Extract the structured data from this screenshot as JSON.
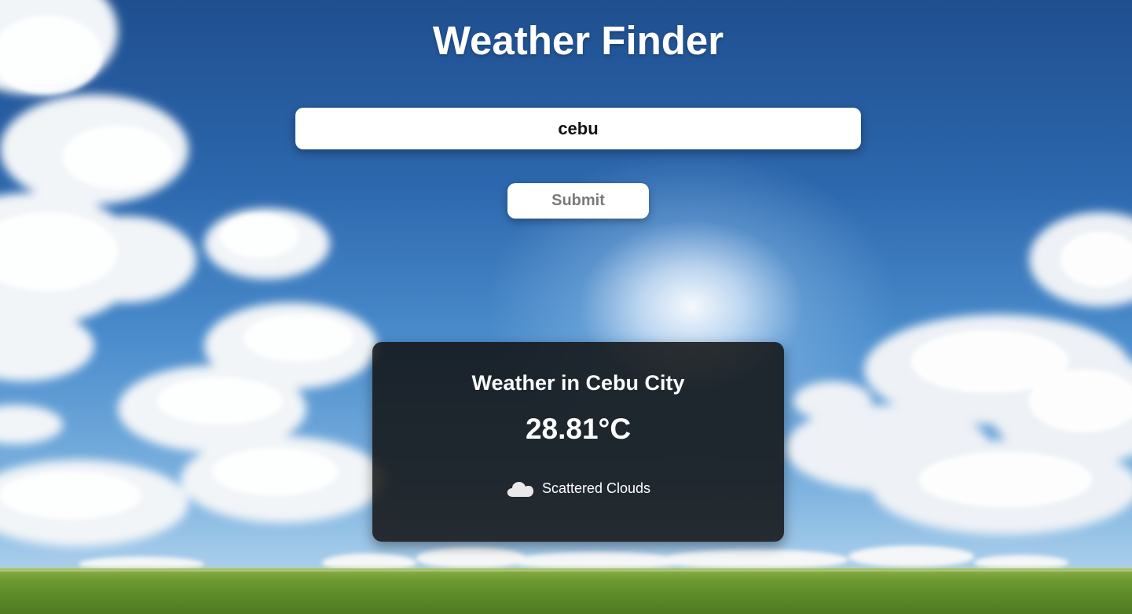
{
  "app": {
    "title": "Weather Finder"
  },
  "search": {
    "value": "cebu",
    "submit_label": "Submit"
  },
  "weather": {
    "location_heading": "Weather in Cebu City",
    "temperature": "28.81°C",
    "description": "Scattered Clouds",
    "icon": "cloud-icon"
  },
  "colors": {
    "card_background": "#121212",
    "text": "#ffffff",
    "submit_text": "#7a7a7a"
  }
}
